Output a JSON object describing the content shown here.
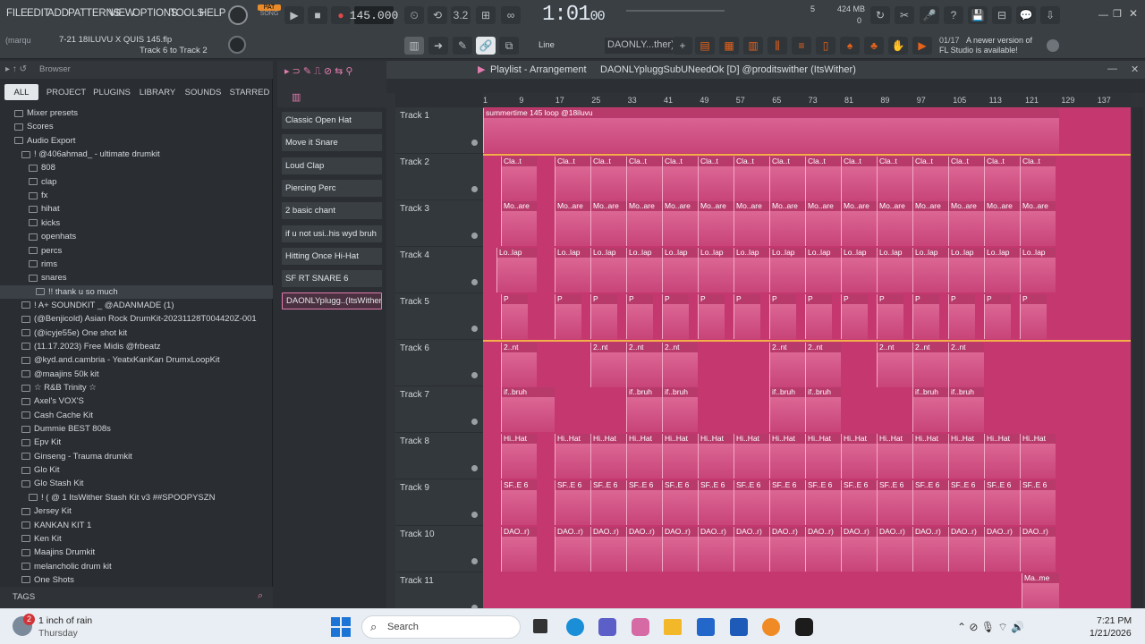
{
  "menu": [
    "FILE",
    "EDIT",
    "ADD",
    "PATTERNS",
    "VIEW",
    "OPTIONS",
    "TOOLS",
    "HELP"
  ],
  "transport": {
    "pat_label": "PAT",
    "song_label": "SONG",
    "tempo": "145.000",
    "time": "1:01",
    "time_small": "00",
    "cpu": "424 MB",
    "cpu2": "0",
    "voices": "5"
  },
  "project": {
    "user": "(marqu",
    "file": "7-21 18ILUVU X QUIS 145.flp",
    "hint": "Track 6 to Track 2"
  },
  "snap": {
    "mode": "Line",
    "pattern": "DAONLY...ther)"
  },
  "notice": {
    "counter": "01/17",
    "text1": "A newer version of",
    "text2": "FL Studio is available!"
  },
  "browser": {
    "title": "Browser",
    "tabs": [
      "ALL",
      "PROJECT",
      "PLUGINS",
      "LIBRARY",
      "SOUNDS",
      "STARRED"
    ],
    "items": [
      {
        "label": "Mixer presets",
        "indent": 1
      },
      {
        "label": "Scores",
        "indent": 1
      },
      {
        "label": "Audio Export",
        "indent": 1
      },
      {
        "label": "! @406ahmad_ - ultimate drumkit",
        "indent": 2
      },
      {
        "label": "808",
        "indent": 3
      },
      {
        "label": "clap",
        "indent": 3
      },
      {
        "label": "fx",
        "indent": 3
      },
      {
        "label": "hihat",
        "indent": 3
      },
      {
        "label": "kicks",
        "indent": 3
      },
      {
        "label": "openhats",
        "indent": 3
      },
      {
        "label": "percs",
        "indent": 3
      },
      {
        "label": "rims",
        "indent": 3
      },
      {
        "label": "snares",
        "indent": 3
      },
      {
        "label": "!! thank u so much",
        "indent": 4
      },
      {
        "label": "! A+ SOUNDKIT _ @ADANMADE (1)",
        "indent": 2
      },
      {
        "label": "(@Benjicold) Asian Rock DrumKit-20231128T004420Z-001",
        "indent": 2
      },
      {
        "label": "(@icyje55e) One shot kit",
        "indent": 2
      },
      {
        "label": "(11.17.2023) Free Midis @frbeatz",
        "indent": 2
      },
      {
        "label": "@kyd.and.cambria - YeatxKanKan DrumxLoopKit",
        "indent": 2
      },
      {
        "label": "@maajins 50k kit",
        "indent": 2
      },
      {
        "label": "☆ R&B Trinity ☆",
        "indent": 2
      },
      {
        "label": "Axel's VOX'S",
        "indent": 2
      },
      {
        "label": "Cash Cache Kit",
        "indent": 2
      },
      {
        "label": "Dummie BEST 808s",
        "indent": 2
      },
      {
        "label": "Epv Kit",
        "indent": 2
      },
      {
        "label": "Ginseng - Trauma drumkit",
        "indent": 2
      },
      {
        "label": "Glo Kit",
        "indent": 2
      },
      {
        "label": "Glo Stash Kit",
        "indent": 2
      },
      {
        "label": "! ( @ 1 ItsWither Stash Kit v3 ##SPOOPYSZN",
        "indent": 3
      },
      {
        "label": "Jersey Kit",
        "indent": 2
      },
      {
        "label": "KANKAN KIT 1",
        "indent": 2
      },
      {
        "label": "Ken Kit",
        "indent": 2
      },
      {
        "label": "Maajins Drumkit",
        "indent": 2
      },
      {
        "label": "melancholic drum kit",
        "indent": 2
      },
      {
        "label": "One Shots",
        "indent": 2
      }
    ],
    "tags_label": "TAGS"
  },
  "channels": [
    "Classic Open Hat",
    "Move it Snare",
    "Loud Clap",
    "Piercing Perc",
    "2 basic chant",
    "if u not usi..his wyd bruh",
    "Hitting Once Hi-Hat",
    "SF RT SNARE 6",
    "DAONLYplugg..(ItsWither)"
  ],
  "playlist": {
    "title": "Playlist - Arrangement",
    "pattern": "DAONLYpluggSubUNeedOk [D] @proditswither (ItsWither)",
    "ruler": [
      "1",
      "9",
      "17",
      "25",
      "33",
      "41",
      "49",
      "57",
      "65",
      "73",
      "81",
      "89",
      "97",
      "105",
      "113",
      "121",
      "129",
      "137"
    ],
    "tracks": [
      {
        "name": "Track 1",
        "clip": "summertime 145 loop @18iluvu"
      },
      {
        "name": "Track 2",
        "clip": "Cla..t"
      },
      {
        "name": "Track 3",
        "clip": "Mo..are"
      },
      {
        "name": "Track 4",
        "clip": "Lo..lap"
      },
      {
        "name": "Track 5",
        "clip": "P"
      },
      {
        "name": "Track 6",
        "clip": "2..nt"
      },
      {
        "name": "Track 7",
        "clip": "if..bruh"
      },
      {
        "name": "Track 8",
        "clip": "Hi..Hat"
      },
      {
        "name": "Track 9",
        "clip": "SF..E 6"
      },
      {
        "name": "Track 10",
        "clip": "DAO..r)"
      },
      {
        "name": "Track 11",
        "clip": "Ma..me"
      }
    ]
  },
  "taskbar": {
    "weather": "1 inch of rain",
    "weather_day": "Thursday",
    "badge": "2",
    "search": "Search",
    "time": "7:21 PM",
    "date": "1/21/2026"
  }
}
